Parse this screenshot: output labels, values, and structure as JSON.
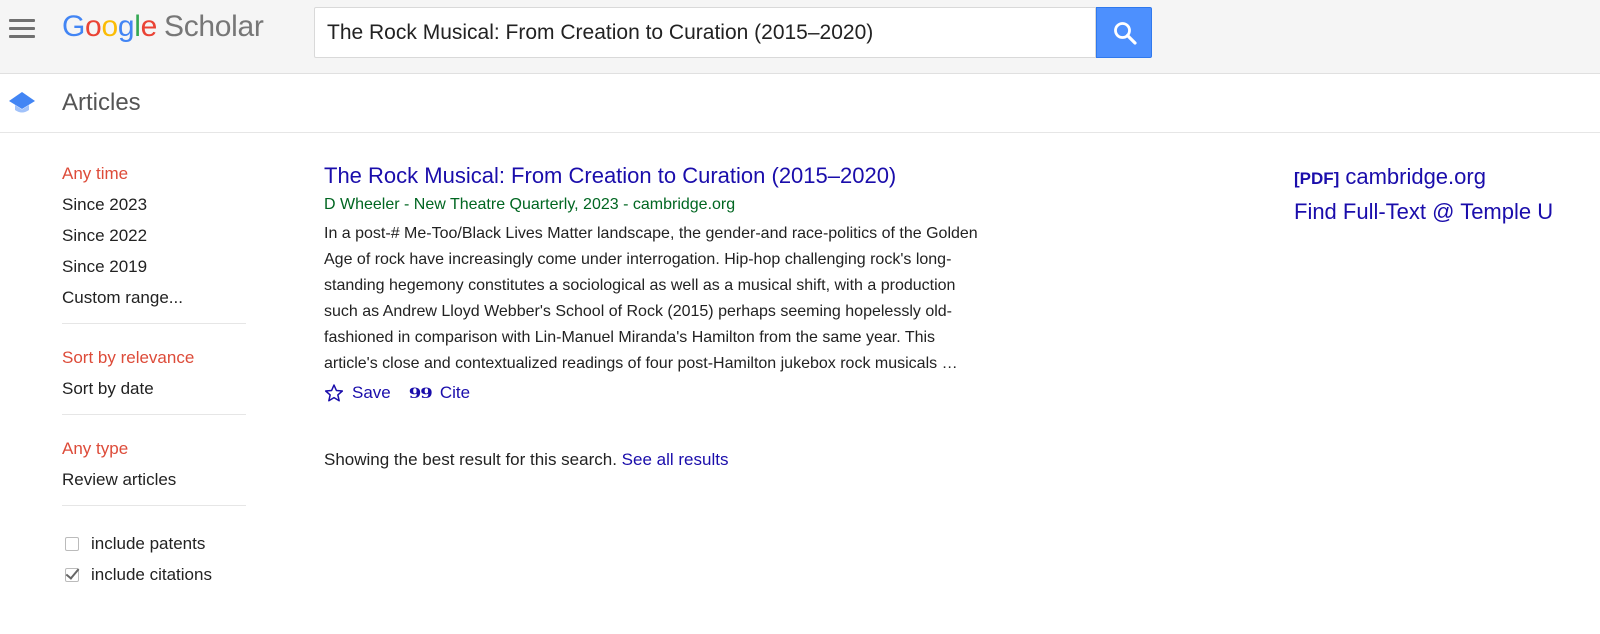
{
  "header": {
    "logo": {
      "letters": [
        "G",
        "o",
        "o",
        "g",
        "l",
        "e"
      ],
      "product": "Scholar"
    },
    "search": {
      "value": "The Rock Musical: From Creation to Curation (2015–2020)",
      "placeholder": ""
    },
    "search_button_icon": "search-icon",
    "menu_icon": "hamburger-menu-icon"
  },
  "subheader": {
    "icon": "graduation-cap-icon",
    "title": "Articles"
  },
  "sidebar": {
    "time_filters": [
      "Any time",
      "Since 2023",
      "Since 2022",
      "Since 2019",
      "Custom range..."
    ],
    "time_selected": "Any time",
    "sort_options": [
      "Sort by relevance",
      "Sort by date"
    ],
    "sort_selected": "Sort by relevance",
    "type_options": [
      "Any type",
      "Review articles"
    ],
    "type_selected": "Any type",
    "checkboxes": [
      {
        "label": "include patents",
        "checked": false
      },
      {
        "label": "include citations",
        "checked": true
      }
    ]
  },
  "result": {
    "title": "The Rock Musical: From Creation to Curation (2015–2020)",
    "meta": "D Wheeler - New Theatre Quarterly, 2023 - cambridge.org",
    "snippet_lines": [
      "In a post-# Me-Too/Black Lives Matter landscape, the gender-and race-politics of the Golden",
      "Age of rock have increasingly come under interrogation. Hip-hop challenging rock's long-",
      "standing hegemony constitutes a sociological as well as a musical shift, with a production",
      "such as Andrew Lloyd Webber's School of Rock (2015) perhaps seeming hopelessly old-",
      "fashioned in comparison with Lin-Manuel Miranda's Hamilton from the same year. This",
      "article's close and contextualized readings of four post-Hamilton jukebox rock musicals …"
    ],
    "actions": {
      "save_label": "Save",
      "cite_label": "Cite",
      "save_icon": "star-outline-icon",
      "cite_icon": "quote-icon"
    }
  },
  "footer_note": {
    "text": "Showing the best result for this search.",
    "link": "See all results"
  },
  "right_links": {
    "pdf_tag": "[PDF]",
    "pdf_source": "cambridge.org",
    "fulltext": "Find Full-Text @ Temple U"
  },
  "colors": {
    "active_filter": "#dd4b39",
    "link": "#1a0dab",
    "meta_green": "#006621",
    "search_button": "#4d90fe"
  }
}
